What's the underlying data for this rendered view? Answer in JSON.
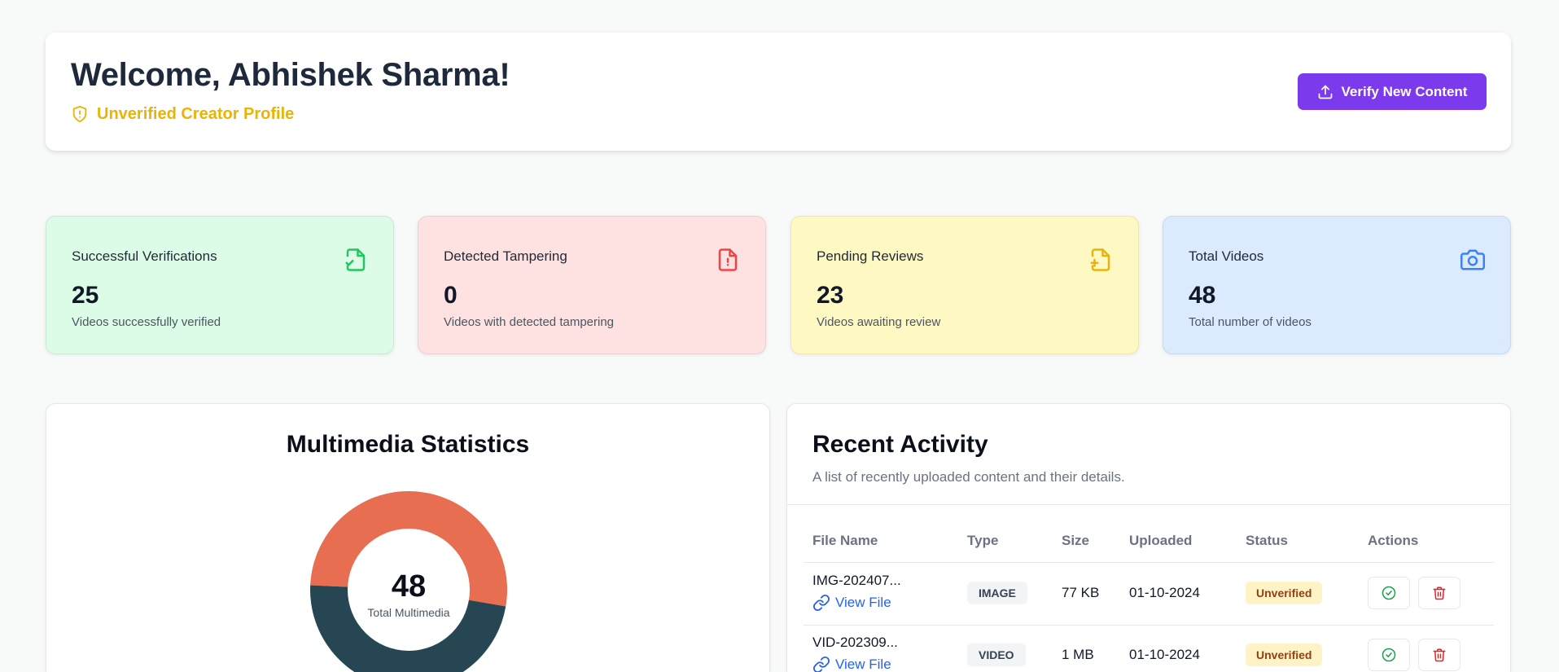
{
  "header": {
    "welcome": "Welcome, Abhishek Sharma!",
    "profile_status": "Unverified Creator Profile",
    "verify_button": "Verify New Content"
  },
  "stats": [
    {
      "title": "Successful Verifications",
      "value": "25",
      "desc": "Videos successfully verified",
      "icon": "file-check-icon",
      "bg": "#dcfce7",
      "accent": "#22c55e"
    },
    {
      "title": "Detected Tampering",
      "value": "0",
      "desc": "Videos with detected tampering",
      "icon": "file-alert-icon",
      "bg": "#fee2e2",
      "accent": "#ef4444"
    },
    {
      "title": "Pending Reviews",
      "value": "23",
      "desc": "Videos awaiting review",
      "icon": "file-plus-icon",
      "bg": "#fef9c3",
      "accent": "#eab308"
    },
    {
      "title": "Total Videos",
      "value": "48",
      "desc": "Total number of videos",
      "icon": "camera-icon",
      "bg": "#dbeafe",
      "accent": "#3b82f6"
    }
  ],
  "chart": {
    "title": "Multimedia Statistics",
    "center_value": "48",
    "center_label": "Total Multimedia"
  },
  "chart_data": {
    "type": "pie",
    "title": "Multimedia Statistics",
    "total": 48,
    "slices": [
      {
        "value": 0.52,
        "color": "#e76e50"
      },
      {
        "value": 0.48,
        "color": "#264653"
      }
    ]
  },
  "activity": {
    "title": "Recent Activity",
    "description": "A list of recently uploaded content and their details.",
    "columns": [
      "File Name",
      "Type",
      "Size",
      "Uploaded",
      "Status",
      "Actions"
    ],
    "view_label": "View File",
    "rows": [
      {
        "file_name": "IMG-202407...",
        "type": "IMAGE",
        "size": "77 KB",
        "uploaded": "01-10-2024",
        "status": "Unverified"
      },
      {
        "file_name": "VID-202309...",
        "type": "VIDEO",
        "size": "1 MB",
        "uploaded": "01-10-2024",
        "status": "Unverified"
      }
    ]
  }
}
